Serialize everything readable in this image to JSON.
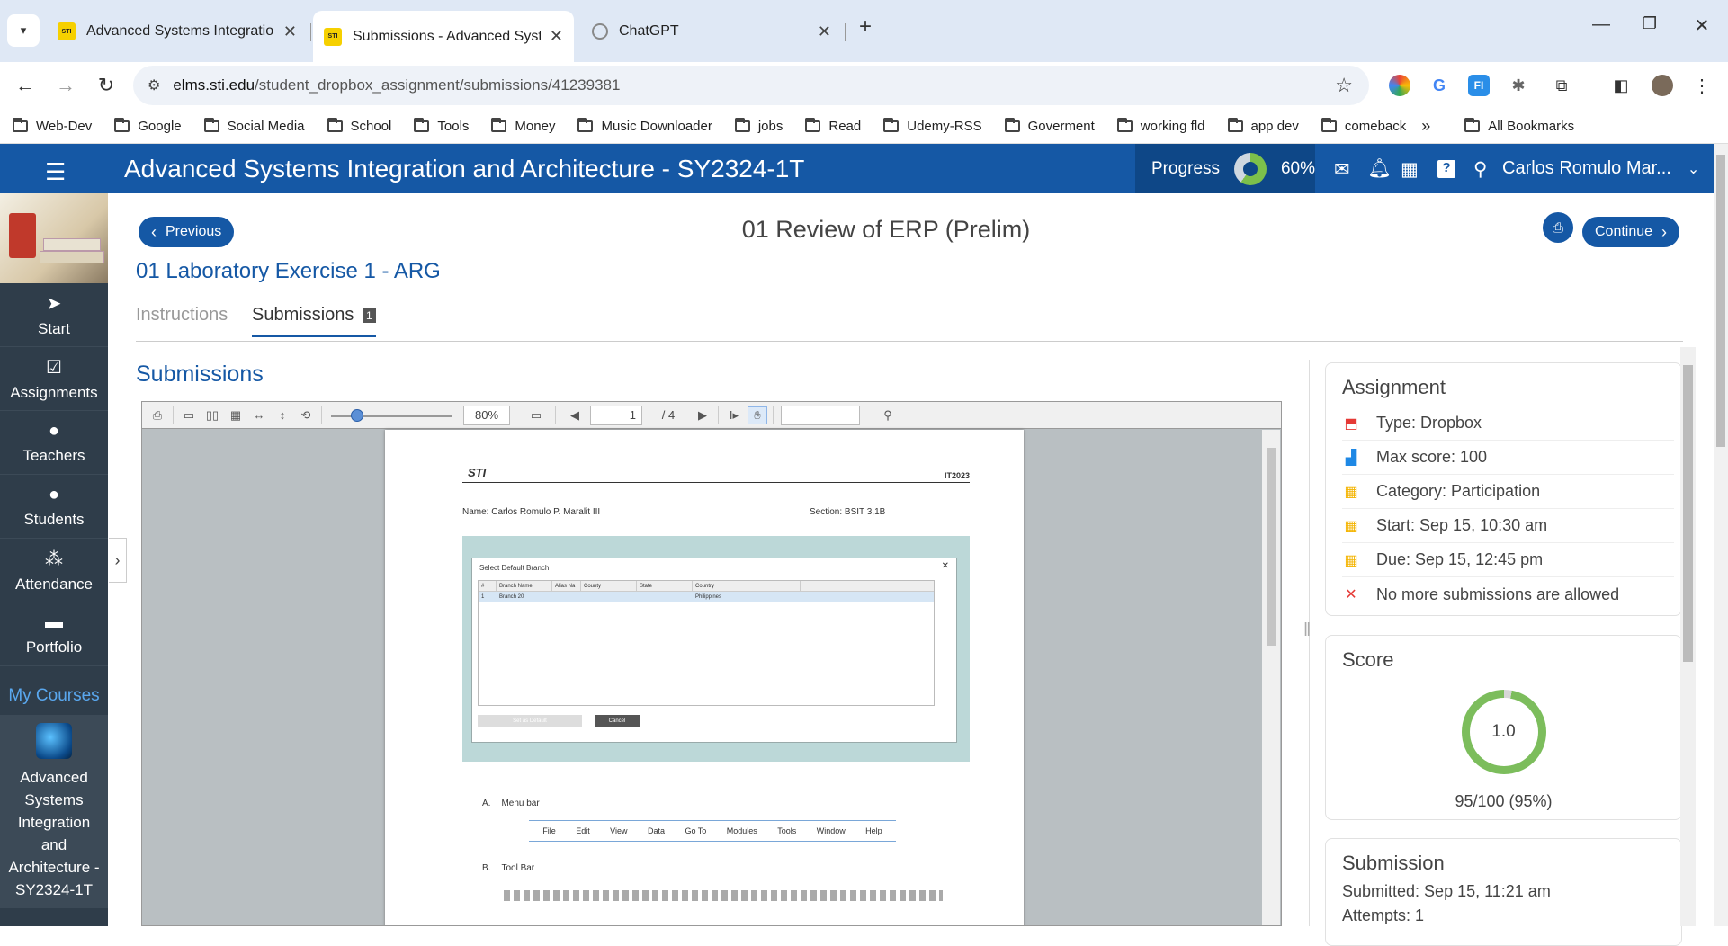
{
  "browser": {
    "tabs": [
      {
        "title": "Advanced Systems Integration",
        "favicon": "STI"
      },
      {
        "title": "Submissions - Advanced Syster",
        "favicon": "STI"
      },
      {
        "title": "ChatGPT",
        "favicon": "chatgpt-icon"
      }
    ],
    "url_host": "elms.sti.edu",
    "url_path": "/student_dropbox_assignment/submissions/41239381",
    "bookmarks": [
      "Web-Dev",
      "Google",
      "Social Media",
      "School",
      "Tools",
      "Money",
      "Music Downloader",
      "jobs",
      "Read",
      "Udemy-RSS",
      "Goverment",
      "working fld",
      "app dev",
      "comeback"
    ],
    "bookmarks_overflow": "»",
    "all_bookmarks": "All Bookmarks"
  },
  "header": {
    "course_title": "Advanced Systems Integration and Architecture - SY2324-1T",
    "progress_label": "Progress",
    "progress_value": "60%",
    "progress_fraction": 0.6,
    "user_name": "Carlos Romulo Mar..."
  },
  "sidebar": {
    "items": [
      {
        "label": "Start",
        "icon": "arrow-icon"
      },
      {
        "label": "Assignments",
        "icon": "checkbox-icon"
      },
      {
        "label": "Teachers",
        "icon": "person-icon"
      },
      {
        "label": "Students",
        "icon": "person-icon"
      },
      {
        "label": "Attendance",
        "icon": "group-icon"
      },
      {
        "label": "Portfolio",
        "icon": "folder-icon"
      }
    ],
    "my_courses": "My Courses",
    "course_card": "Advanced Systems Integration and Architecture - SY2324-1T"
  },
  "main": {
    "previous": "Previous",
    "continue": "Continue",
    "activity_title": "01 Review of ERP (Prelim)",
    "lab_title": "01 Laboratory Exercise 1 - ARG",
    "tabs": {
      "instructions": "Instructions",
      "submissions": "Submissions",
      "submissions_count": "1"
    },
    "section_heading": "Submissions"
  },
  "viewer": {
    "zoom": "80%",
    "page": "1",
    "page_total": "/ 4",
    "zoom_fraction": 0.18,
    "doc": {
      "logo": "STI",
      "code": "IT2023",
      "name_line": "Name: Carlos Romulo P. Maralit III",
      "section_line": "Section: BSIT 3,1B",
      "dialog_title": "Select Default Branch",
      "dialog_headers": [
        "#",
        "Branch Name",
        "Alias Na",
        "County",
        "State",
        "Country"
      ],
      "dialog_row": [
        "1",
        "Branch 20",
        "",
        "",
        "",
        "Philippines"
      ],
      "set_default": "Set as Default",
      "cancel": "Cancel",
      "item_a": "A.",
      "item_a_label": "Menu bar",
      "menu_items": [
        "File",
        "Edit",
        "View",
        "Data",
        "Go To",
        "Modules",
        "Tools",
        "Window",
        "Help"
      ],
      "item_b": "B.",
      "item_b_label": "Tool Bar"
    }
  },
  "assignment": {
    "heading": "Assignment",
    "rows": [
      {
        "icon": "dropbox-icon",
        "text": "Type: Dropbox",
        "color": "#e53935"
      },
      {
        "icon": "bar-chart-icon",
        "text": "Max score: 100",
        "color": "#1e88e5"
      },
      {
        "icon": "category-icon",
        "text": "Category: Participation",
        "color": "#f4b400"
      },
      {
        "icon": "calendar-icon",
        "text": "Start: Sep 15, 10:30 am",
        "color": "#f4b400"
      },
      {
        "icon": "calendar-icon",
        "text": "Due: Sep 15, 12:45 pm",
        "color": "#f4b400"
      },
      {
        "icon": "close-icon",
        "text": "No more submissions are allowed",
        "color": "#e53935"
      }
    ]
  },
  "score": {
    "heading": "Score",
    "value": "1.0",
    "fraction_text": "95/100 (95%)",
    "fraction": 0.95
  },
  "submission": {
    "heading": "Submission",
    "submitted": "Submitted: Sep 15, 11:21 am",
    "attempts": "Attempts: 1"
  }
}
